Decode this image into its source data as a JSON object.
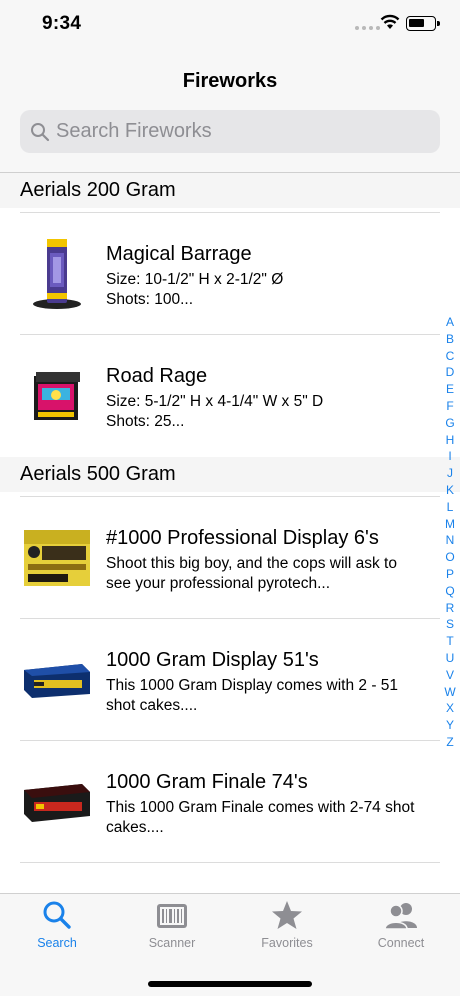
{
  "status_bar": {
    "time": "9:34"
  },
  "nav": {
    "title": "Fireworks"
  },
  "search": {
    "placeholder": "Search Fireworks",
    "value": ""
  },
  "sections": [
    {
      "header": "Aerials 200 Gram",
      "items": [
        {
          "name": "Magical Barrage",
          "line1": "Size: 10-1/2\" H x 2-1/2\" Ø",
          "line2": "Shots: 100..."
        },
        {
          "name": "Road Rage",
          "line1": "Size: 5-1/2\" H x 4-1/4\" W x 5\" D",
          "line2": "Shots: 25..."
        }
      ]
    },
    {
      "header": "Aerials 500 Gram",
      "items": [
        {
          "name": "#1000 Professional Display 6's",
          "desc": "Shoot this big boy, and the cops will ask to see your professional pyrotech..."
        },
        {
          "name": "1000 Gram Display 51's",
          "desc": "This 1000 Gram Display comes with 2 - 51 shot cakes...."
        },
        {
          "name": "1000 Gram Finale 74's",
          "desc": "This 1000 Gram Finale comes with 2-74 shot cakes...."
        }
      ]
    }
  ],
  "index_letters": [
    "A",
    "B",
    "C",
    "D",
    "E",
    "F",
    "G",
    "H",
    "I",
    "J",
    "K",
    "L",
    "M",
    "N",
    "O",
    "P",
    "Q",
    "R",
    "S",
    "T",
    "U",
    "V",
    "W",
    "X",
    "Y",
    "Z"
  ],
  "tabs": [
    {
      "label": "Search",
      "icon": "search-icon",
      "active": true
    },
    {
      "label": "Scanner",
      "icon": "barcode-icon",
      "active": false
    },
    {
      "label": "Favorites",
      "icon": "star-icon",
      "active": false
    },
    {
      "label": "Connect",
      "icon": "people-icon",
      "active": false
    }
  ],
  "colors": {
    "accent": "#1a82ea",
    "inactive": "#8e8e93",
    "bar_bg": "#f7f7f7"
  }
}
